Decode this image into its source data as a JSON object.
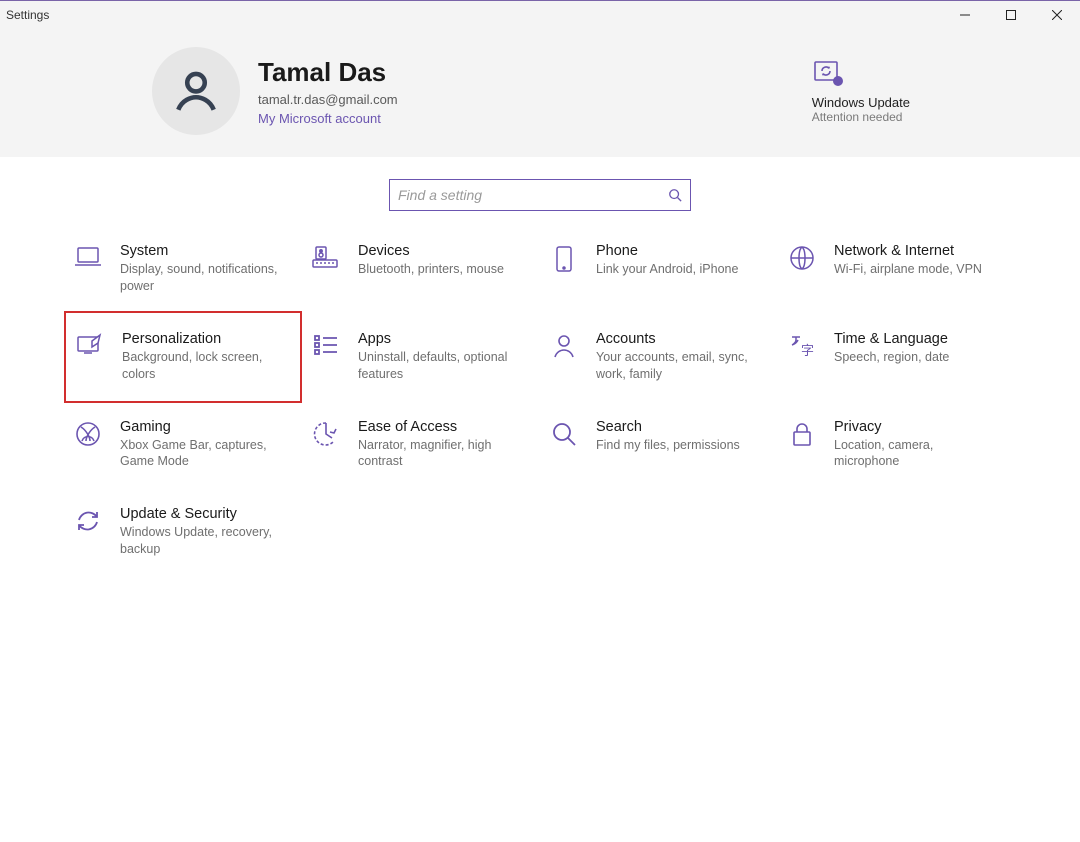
{
  "window": {
    "title": "Settings"
  },
  "user": {
    "name": "Tamal Das",
    "email": "tamal.tr.das@gmail.com",
    "account_link": "My Microsoft account"
  },
  "windows_update": {
    "title": "Windows Update",
    "subtitle": "Attention needed"
  },
  "search": {
    "placeholder": "Find a setting"
  },
  "tiles": [
    {
      "id": "system",
      "title": "System",
      "desc": "Display, sound, notifications, power"
    },
    {
      "id": "devices",
      "title": "Devices",
      "desc": "Bluetooth, printers, mouse"
    },
    {
      "id": "phone",
      "title": "Phone",
      "desc": "Link your Android, iPhone"
    },
    {
      "id": "network",
      "title": "Network & Internet",
      "desc": "Wi-Fi, airplane mode, VPN"
    },
    {
      "id": "personalization",
      "title": "Personalization",
      "desc": "Background, lock screen, colors",
      "highlight": true
    },
    {
      "id": "apps",
      "title": "Apps",
      "desc": "Uninstall, defaults, optional features"
    },
    {
      "id": "accounts",
      "title": "Accounts",
      "desc": "Your accounts, email, sync, work, family"
    },
    {
      "id": "time-language",
      "title": "Time & Language",
      "desc": "Speech, region, date"
    },
    {
      "id": "gaming",
      "title": "Gaming",
      "desc": "Xbox Game Bar, captures, Game Mode"
    },
    {
      "id": "ease-of-access",
      "title": "Ease of Access",
      "desc": "Narrator, magnifier, high contrast"
    },
    {
      "id": "search",
      "title": "Search",
      "desc": "Find my files, permissions"
    },
    {
      "id": "privacy",
      "title": "Privacy",
      "desc": "Location, camera, microphone"
    },
    {
      "id": "update-security",
      "title": "Update & Security",
      "desc": "Windows Update, recovery, backup"
    }
  ],
  "colors": {
    "accent": "#6b55b0",
    "highlight": "#d22e2e"
  }
}
